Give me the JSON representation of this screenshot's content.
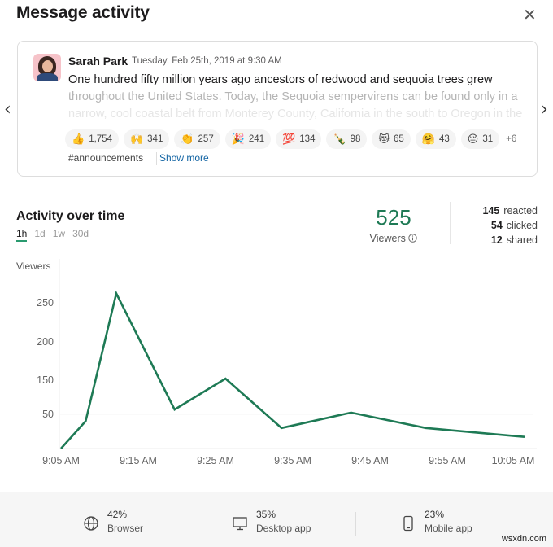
{
  "header": {
    "title": "Message activity",
    "close_icon": "close-icon"
  },
  "message": {
    "author": "Sarah Park",
    "timestamp": "Tuesday, Feb 25th, 2019 at 9:30 AM",
    "lines": [
      "One hundred fifty million years ago ancestors of redwood and sequoia trees grew",
      "throughout the United States. Today, the Sequoia sempervirens can be found only in a",
      "narrow, cool coastal belt from Monterey County, California in the south to Oregon in the"
    ],
    "reactions": [
      {
        "icon": "thumbs-up",
        "glyph": "👍",
        "count": "1,754"
      },
      {
        "icon": "raised-hands",
        "glyph": "🙌",
        "count": "341"
      },
      {
        "icon": "clapping-hands",
        "glyph": "👏",
        "count": "257"
      },
      {
        "icon": "party-popper",
        "glyph": "🎉",
        "count": "241"
      },
      {
        "icon": "hundred-points",
        "glyph": "💯",
        "count": "134"
      },
      {
        "icon": "champagne-bottle",
        "glyph": "🍾",
        "count": "98"
      },
      {
        "icon": "heart-eyes-cat",
        "glyph": "😻",
        "count": "65"
      },
      {
        "icon": "hugging-face",
        "glyph": "🤗",
        "count": "43"
      },
      {
        "icon": "pensive-face",
        "glyph": "😔",
        "count": "31"
      }
    ],
    "more_reactions": "+6",
    "channel": "#announcements",
    "show_more": "Show more"
  },
  "activity": {
    "title": "Activity over time",
    "ranges": [
      "1h",
      "1d",
      "1w",
      "30d"
    ],
    "active_range": "1h",
    "viewers_count": "525",
    "viewers_label": "Viewers",
    "stats": [
      {
        "value": "145",
        "label": "reacted"
      },
      {
        "value": "54",
        "label": "clicked"
      },
      {
        "value": "12",
        "label": "shared"
      }
    ]
  },
  "chart_data": {
    "type": "line",
    "title": "",
    "ylabel": "Viewers",
    "xlabel": "",
    "x_ticks": [
      "9:05 AM",
      "9:15 AM",
      "9:25 AM",
      "9:35 AM",
      "9:45 AM",
      "9:55 AM",
      "10:05 AM"
    ],
    "y_ticks": [
      50,
      150,
      200,
      250
    ],
    "ylim": [
      0,
      275
    ],
    "grid": "horizontal at 50",
    "series": [
      {
        "name": "Viewers",
        "color": "#1e7a55",
        "x_minutes": [
          0,
          3.3,
          7.4,
          15.2,
          22,
          29.5,
          38.8,
          48.8,
          62
        ],
        "values": [
          0,
          40,
          262,
          64,
          152,
          30,
          55,
          30,
          17
        ]
      }
    ]
  },
  "footer": {
    "devices": [
      {
        "icon": "globe-icon",
        "percent": "42%",
        "label": "Browser"
      },
      {
        "icon": "desktop-icon",
        "percent": "35%",
        "label": "Desktop app"
      },
      {
        "icon": "mobile-icon",
        "percent": "23%",
        "label": "Mobile app"
      }
    ],
    "watermark": "wsxdn.com"
  }
}
